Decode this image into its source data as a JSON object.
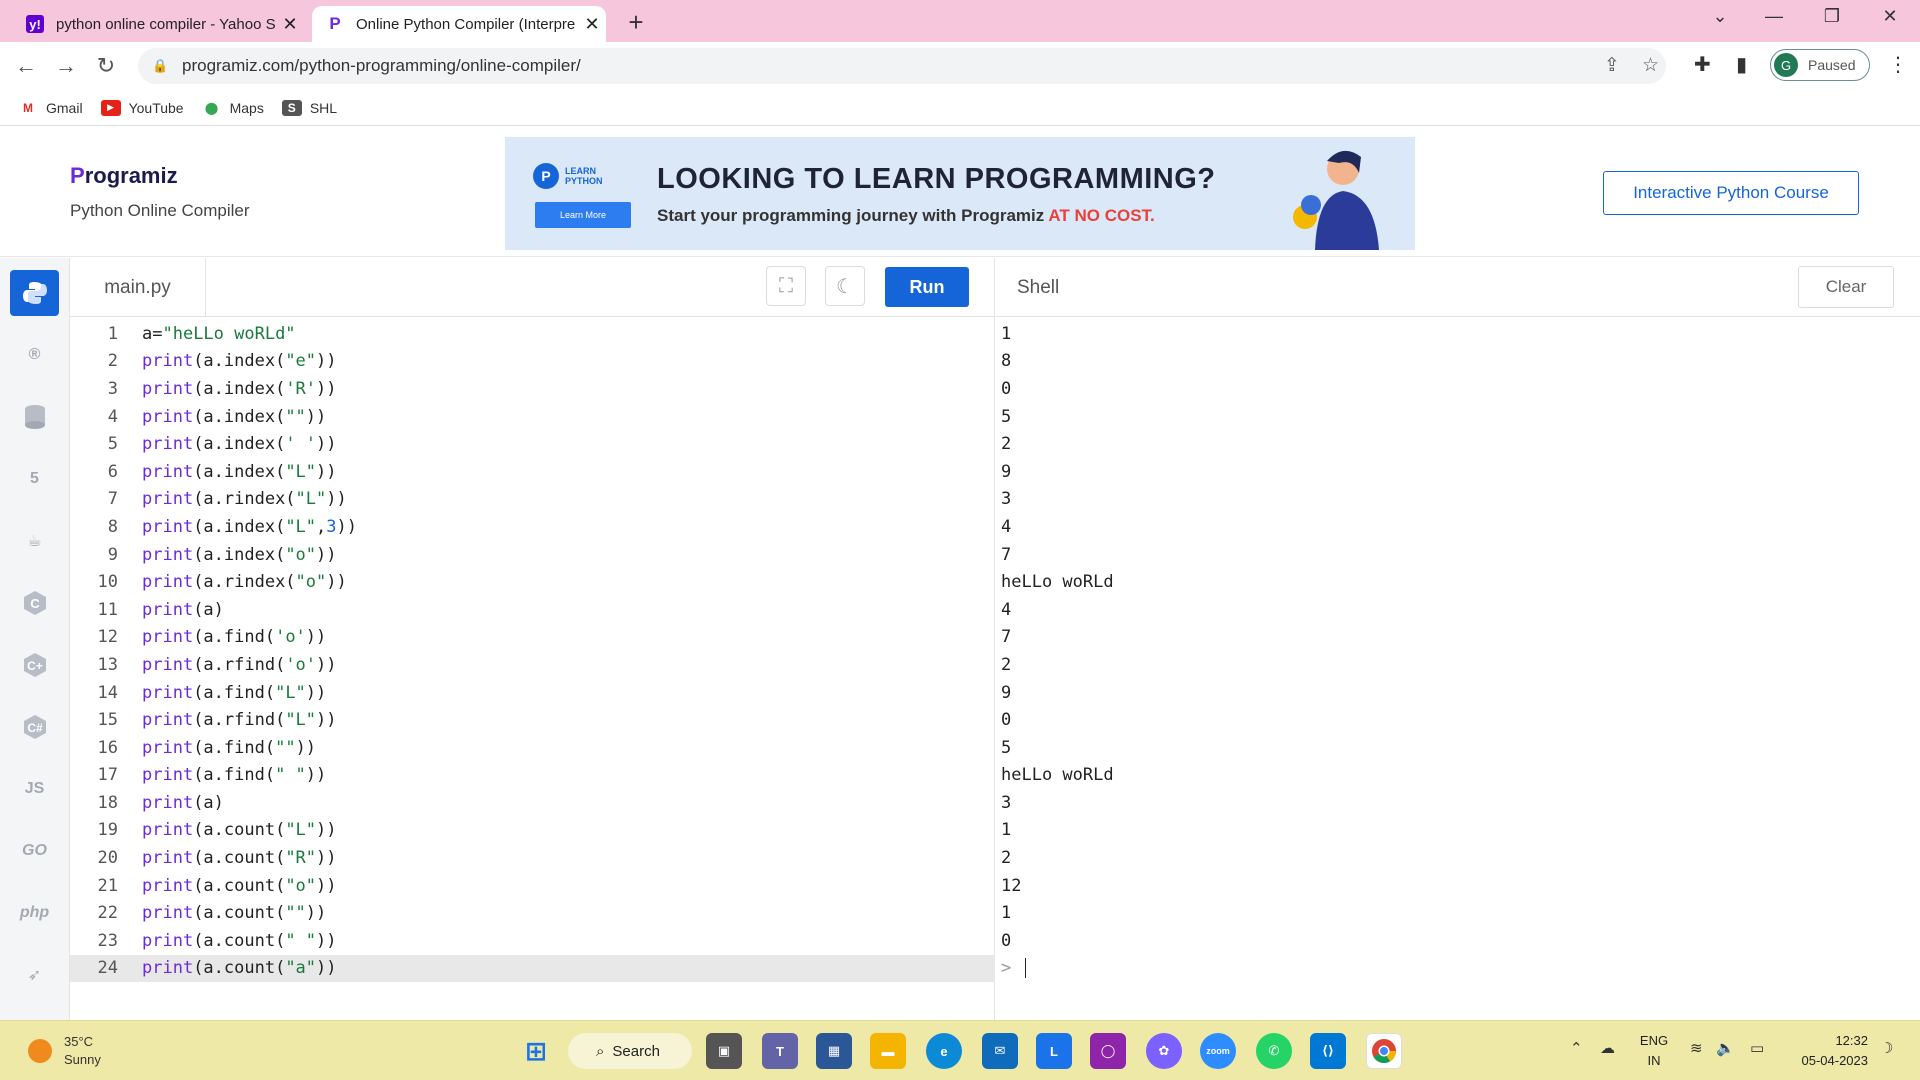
{
  "browser": {
    "tabs": [
      {
        "title": "python online compiler - Yahoo S",
        "favicon": "yahoo-icon",
        "active": false
      },
      {
        "title": "Online Python Compiler (Interpre",
        "favicon": "programiz-icon",
        "active": true
      }
    ],
    "url": "programiz.com/python-programming/online-compiler/",
    "profile_initial": "G",
    "profile_status": "Paused",
    "bookmarks": [
      {
        "label": "Gmail",
        "icon": "gmail-icon"
      },
      {
        "label": "YouTube",
        "icon": "youtube-icon"
      },
      {
        "label": "Maps",
        "icon": "maps-icon"
      },
      {
        "label": "SHL",
        "icon": "shl-icon"
      }
    ]
  },
  "site": {
    "logo_initial": "P",
    "logo_rest": "rogramiz",
    "subtitle": "Python Online Compiler",
    "course_button": "Interactive Python Course",
    "banner": {
      "badge_line1": "LEARN",
      "badge_line2": "PYTHON",
      "learn_more": "Learn More",
      "headline": "LOOKING TO LEARN PROGRAMMING?",
      "subline": "Start your programming journey with Programiz ",
      "subline_accent": "AT NO COST."
    }
  },
  "languages": [
    "python-icon",
    "r-icon",
    "sql-icon",
    "html5-icon",
    "java-icon",
    "c-icon",
    "cpp-icon",
    "csharp-icon",
    "JS",
    "GO",
    "php",
    "swift-icon"
  ],
  "editor": {
    "filename": "main.py",
    "run_label": "Run",
    "current_line": 24,
    "lines": [
      "a=\"heLLo woRLd\"",
      "print(a.index(\"e\"))",
      "print(a.index('R'))",
      "print(a.index(\"\"))",
      "print(a.index(' '))",
      "print(a.index(\"L\"))",
      "print(a.rindex(\"L\"))",
      "print(a.index(\"L\",3))",
      "print(a.index(\"o\"))",
      "print(a.rindex(\"o\"))",
      "print(a)",
      "print(a.find('o'))",
      "print(a.rfind('o'))",
      "print(a.find(\"L\"))",
      "print(a.rfind(\"L\"))",
      "print(a.find(\"\"))",
      "print(a.find(\" \"))",
      "print(a)",
      "print(a.count(\"L\"))",
      "print(a.count(\"R\"))",
      "print(a.count(\"o\"))",
      "print(a.count(\"\"))",
      "print(a.count(\" \"))",
      "print(a.count(\"a\"))"
    ]
  },
  "shell": {
    "title": "Shell",
    "clear_label": "Clear",
    "output": [
      "1",
      "8",
      "0",
      "5",
      "2",
      "9",
      "3",
      "4",
      "7",
      "heLLo woRLd",
      "4",
      "7",
      "2",
      "9",
      "0",
      "5",
      "heLLo woRLd",
      "3",
      "1",
      "2",
      "12",
      "1",
      "0"
    ],
    "prompt": "> "
  },
  "taskbar": {
    "temperature": "35°C",
    "weather": "Sunny",
    "search_label": "Search",
    "lang_line1": "ENG",
    "lang_line2": "IN",
    "time": "12:32",
    "date": "05-04-2023"
  }
}
